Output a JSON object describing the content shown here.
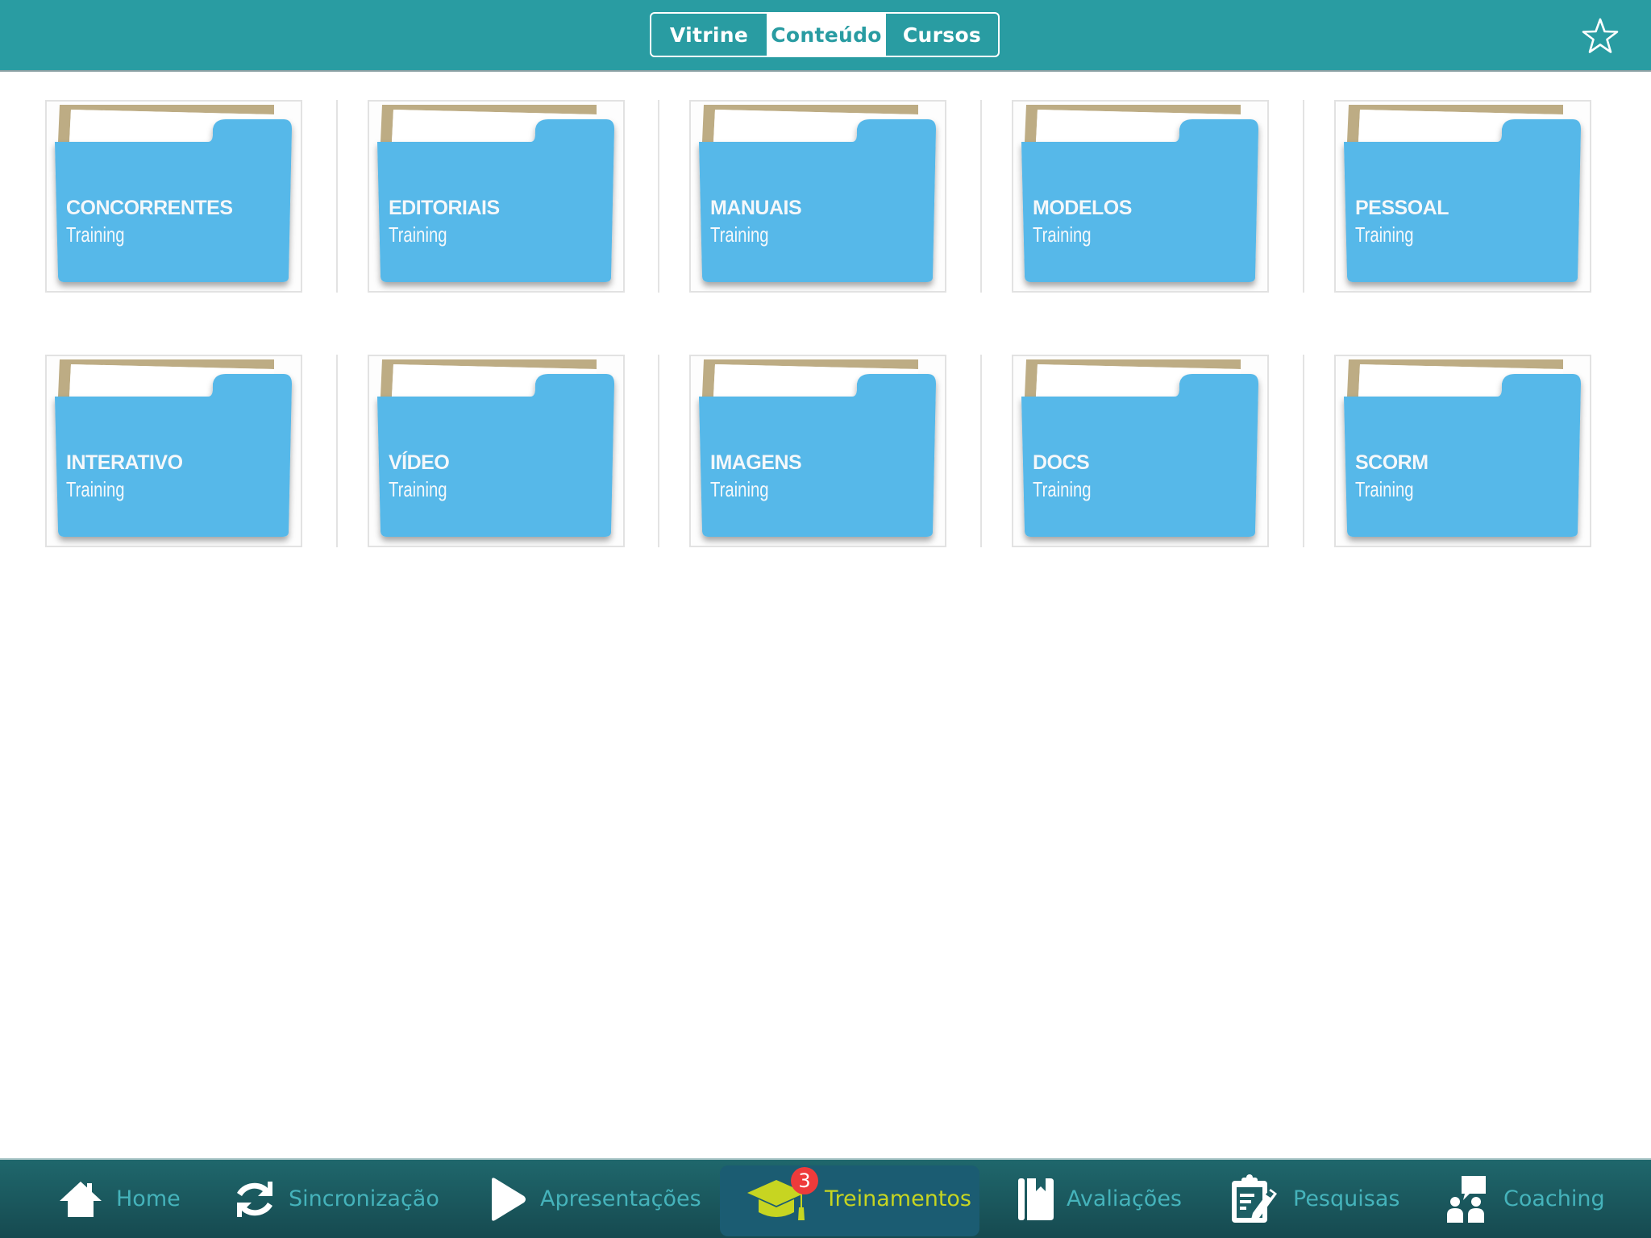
{
  "header": {
    "segments": [
      {
        "label": "Vitrine",
        "selected": false
      },
      {
        "label": "Conteúdo",
        "selected": true
      },
      {
        "label": "Cursos",
        "selected": false
      }
    ],
    "favorite_icon": "star-outline-icon"
  },
  "folders": [
    {
      "title": "CONCORRENTES",
      "subtitle": "Training"
    },
    {
      "title": "EDITORIAIS",
      "subtitle": "Training"
    },
    {
      "title": "MANUAIS",
      "subtitle": "Training"
    },
    {
      "title": "MODELOS",
      "subtitle": "Training"
    },
    {
      "title": "PESSOAL",
      "subtitle": "Training"
    },
    {
      "title": "INTERATIVO",
      "subtitle": "Training"
    },
    {
      "title": "VÍDEO",
      "subtitle": "Training"
    },
    {
      "title": "IMAGENS",
      "subtitle": "Training"
    },
    {
      "title": "DOCS",
      "subtitle": "Training"
    },
    {
      "title": "SCORM",
      "subtitle": "Training"
    }
  ],
  "tabbar": {
    "items": [
      {
        "label": "Home",
        "icon": "home-icon"
      },
      {
        "label": "Sincronização",
        "icon": "sync-icon"
      },
      {
        "label": "Apresentações",
        "icon": "play-icon"
      },
      {
        "label": "Treinamentos",
        "icon": "graduation-cap-icon",
        "active": true,
        "badge": "3"
      },
      {
        "label": "Avaliações",
        "icon": "book-icon"
      },
      {
        "label": "Pesquisas",
        "icon": "clipboard-edit-icon"
      },
      {
        "label": "Coaching",
        "icon": "coaching-icon"
      }
    ]
  },
  "colors": {
    "header": "#299ca2",
    "folder": "#56b8e9",
    "tab_label": "#45b3bb",
    "tab_active_label": "#c7d521",
    "badge": "#ee3b3b"
  }
}
